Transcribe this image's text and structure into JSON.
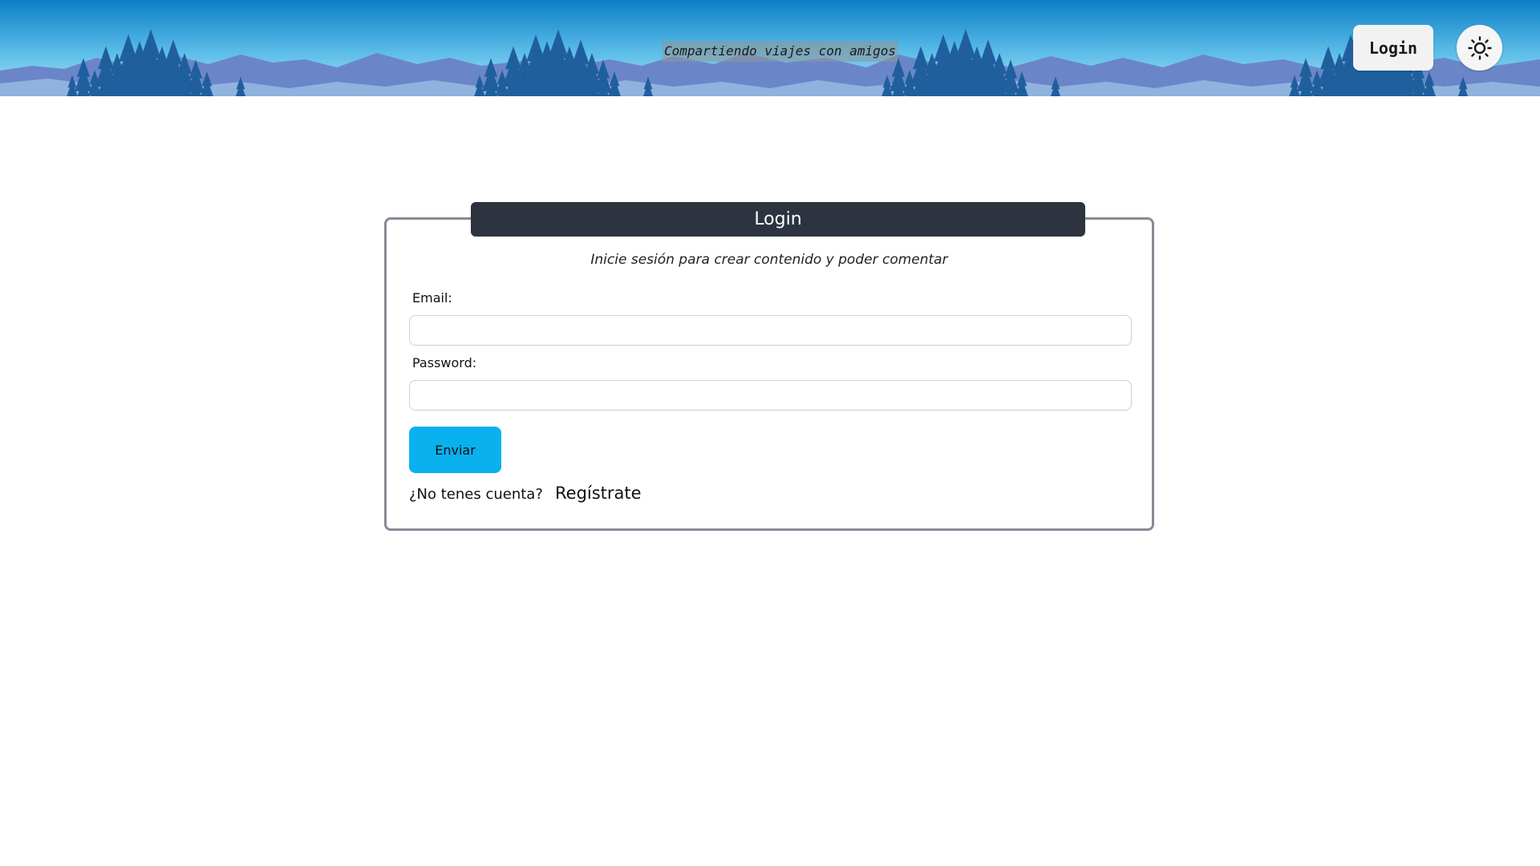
{
  "header": {
    "tagline": "Compartiendo viajes con amigos",
    "login_label": "Login",
    "theme_toggle_icon": "sun-icon"
  },
  "login_card": {
    "title": "Login",
    "subtitle": "Inicie sesión para crear contenido y poder comentar",
    "email_label": "Email:",
    "email_value": "",
    "password_label": "Password:",
    "password_value": "",
    "submit_label": "Enviar",
    "no_account_text": "¿No tenes cuenta?",
    "register_link": "Regístrate"
  },
  "colors": {
    "sky_top": "#0a7fc6",
    "sky_bottom": "#9fd7f2",
    "mountains": "#6a86c9",
    "trees": "#1f5f9e",
    "card_header": "#2d3440",
    "submit_button": "#0ab1ef"
  }
}
